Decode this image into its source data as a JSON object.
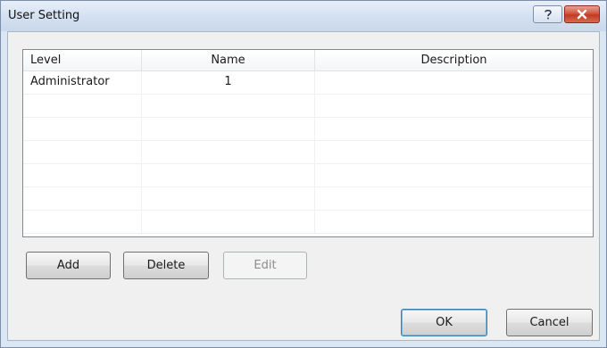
{
  "window": {
    "title": "User Setting",
    "help_glyph": "?",
    "close_glyph": "x"
  },
  "grid": {
    "columns": [
      "Level",
      "Name",
      "Description"
    ],
    "rows": [
      [
        "Administrator",
        "1",
        ""
      ],
      [
        "",
        "",
        ""
      ],
      [
        "",
        "",
        ""
      ],
      [
        "",
        "",
        ""
      ],
      [
        "",
        "",
        ""
      ],
      [
        "",
        "",
        ""
      ],
      [
        "",
        "",
        ""
      ]
    ]
  },
  "buttons": {
    "add": "Add",
    "delete": "Delete",
    "edit": "Edit",
    "ok": "OK",
    "cancel": "Cancel"
  },
  "colors": {
    "title_bar": "#d3e0f0",
    "close_button": "#c94a33",
    "dialog_body": "#f0f0f0"
  },
  "icons": [
    "help-icon",
    "close-icon"
  ]
}
